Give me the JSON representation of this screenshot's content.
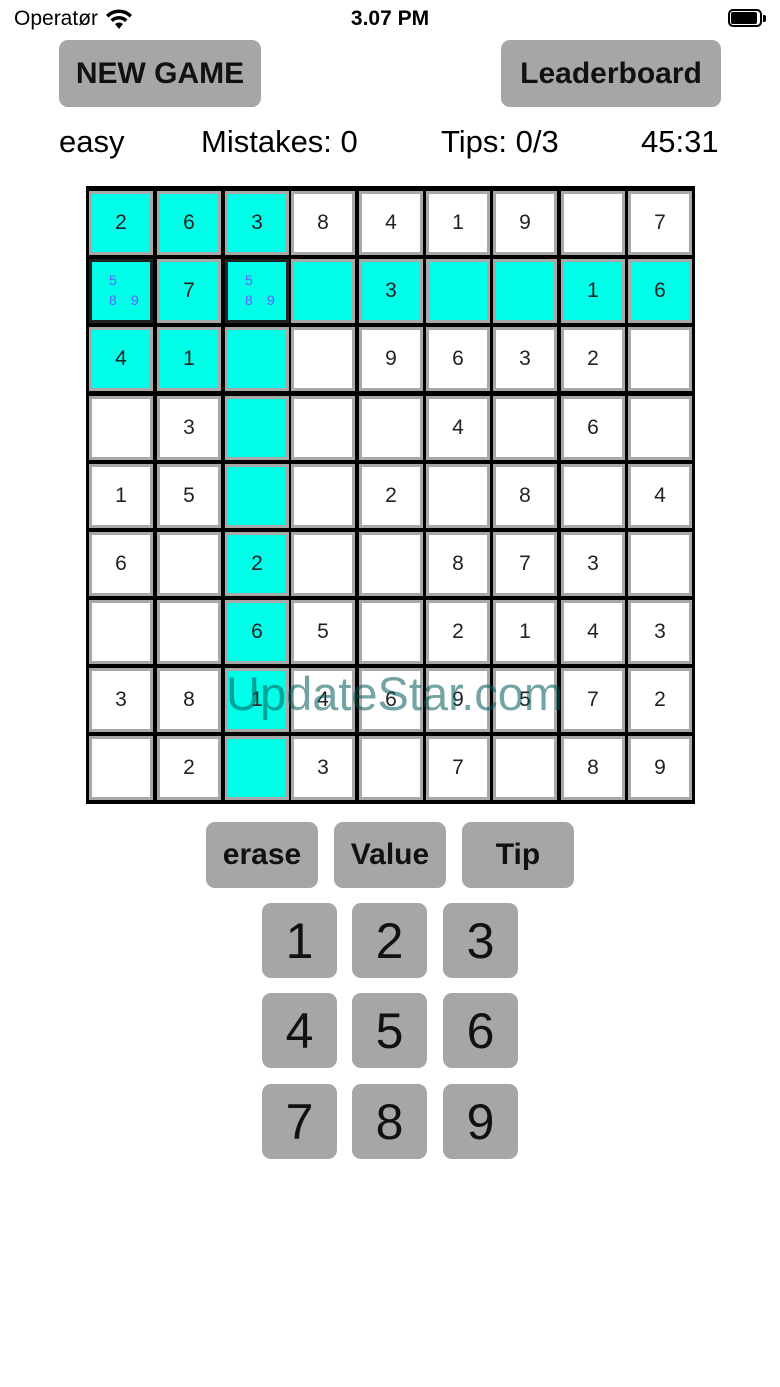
{
  "status_bar": {
    "carrier": "Operatør",
    "time": "3.07 PM"
  },
  "header": {
    "new_game_label": "NEW GAME",
    "leaderboard_label": "Leaderboard"
  },
  "info": {
    "difficulty": "easy",
    "mistakes": "Mistakes: 0",
    "tips": "Tips: 0/3",
    "timer": "45:31"
  },
  "board": {
    "rows": [
      [
        "2",
        "6",
        "3",
        "8",
        "4",
        "1",
        "9",
        "",
        "7"
      ],
      [
        "",
        "7",
        "",
        "",
        "3",
        "",
        "",
        "1",
        "6"
      ],
      [
        "4",
        "1",
        "",
        "",
        "9",
        "6",
        "3",
        "2",
        ""
      ],
      [
        "",
        "3",
        "",
        "",
        "",
        "4",
        "",
        "6",
        ""
      ],
      [
        "1",
        "5",
        "",
        "",
        "2",
        "",
        "8",
        "",
        "4"
      ],
      [
        "6",
        "",
        "2",
        "",
        "",
        "8",
        "7",
        "3",
        ""
      ],
      [
        "",
        "",
        "6",
        "5",
        "",
        "2",
        "1",
        "4",
        "3"
      ],
      [
        "3",
        "8",
        "1",
        "4",
        "6",
        "9",
        "5",
        "7",
        "2"
      ],
      [
        "",
        "2",
        "",
        "3",
        "",
        "7",
        "",
        "8",
        "9"
      ]
    ],
    "highlighted": [
      [
        0,
        0
      ],
      [
        0,
        1
      ],
      [
        0,
        2
      ],
      [
        1,
        0
      ],
      [
        1,
        1
      ],
      [
        1,
        2
      ],
      [
        1,
        3
      ],
      [
        1,
        4
      ],
      [
        1,
        5
      ],
      [
        1,
        6
      ],
      [
        1,
        7
      ],
      [
        1,
        8
      ],
      [
        2,
        0
      ],
      [
        2,
        1
      ],
      [
        2,
        2
      ],
      [
        3,
        2
      ],
      [
        4,
        2
      ],
      [
        5,
        2
      ],
      [
        6,
        2
      ],
      [
        7,
        2
      ],
      [
        8,
        2
      ]
    ],
    "notes": {
      "1,0": [
        "5",
        "8",
        "9"
      ],
      "1,2": [
        "5",
        "8",
        "9"
      ]
    },
    "selected": [
      [
        1,
        0
      ],
      [
        1,
        2
      ]
    ],
    "highlight_color": "#00ffe8",
    "note_color": "#6b5cff"
  },
  "watermark": "UpdateStar.com",
  "actions": {
    "erase_label": "erase",
    "value_label": "Value",
    "tip_label": "Tip"
  },
  "numpad": [
    "1",
    "2",
    "3",
    "4",
    "5",
    "6",
    "7",
    "8",
    "9"
  ]
}
